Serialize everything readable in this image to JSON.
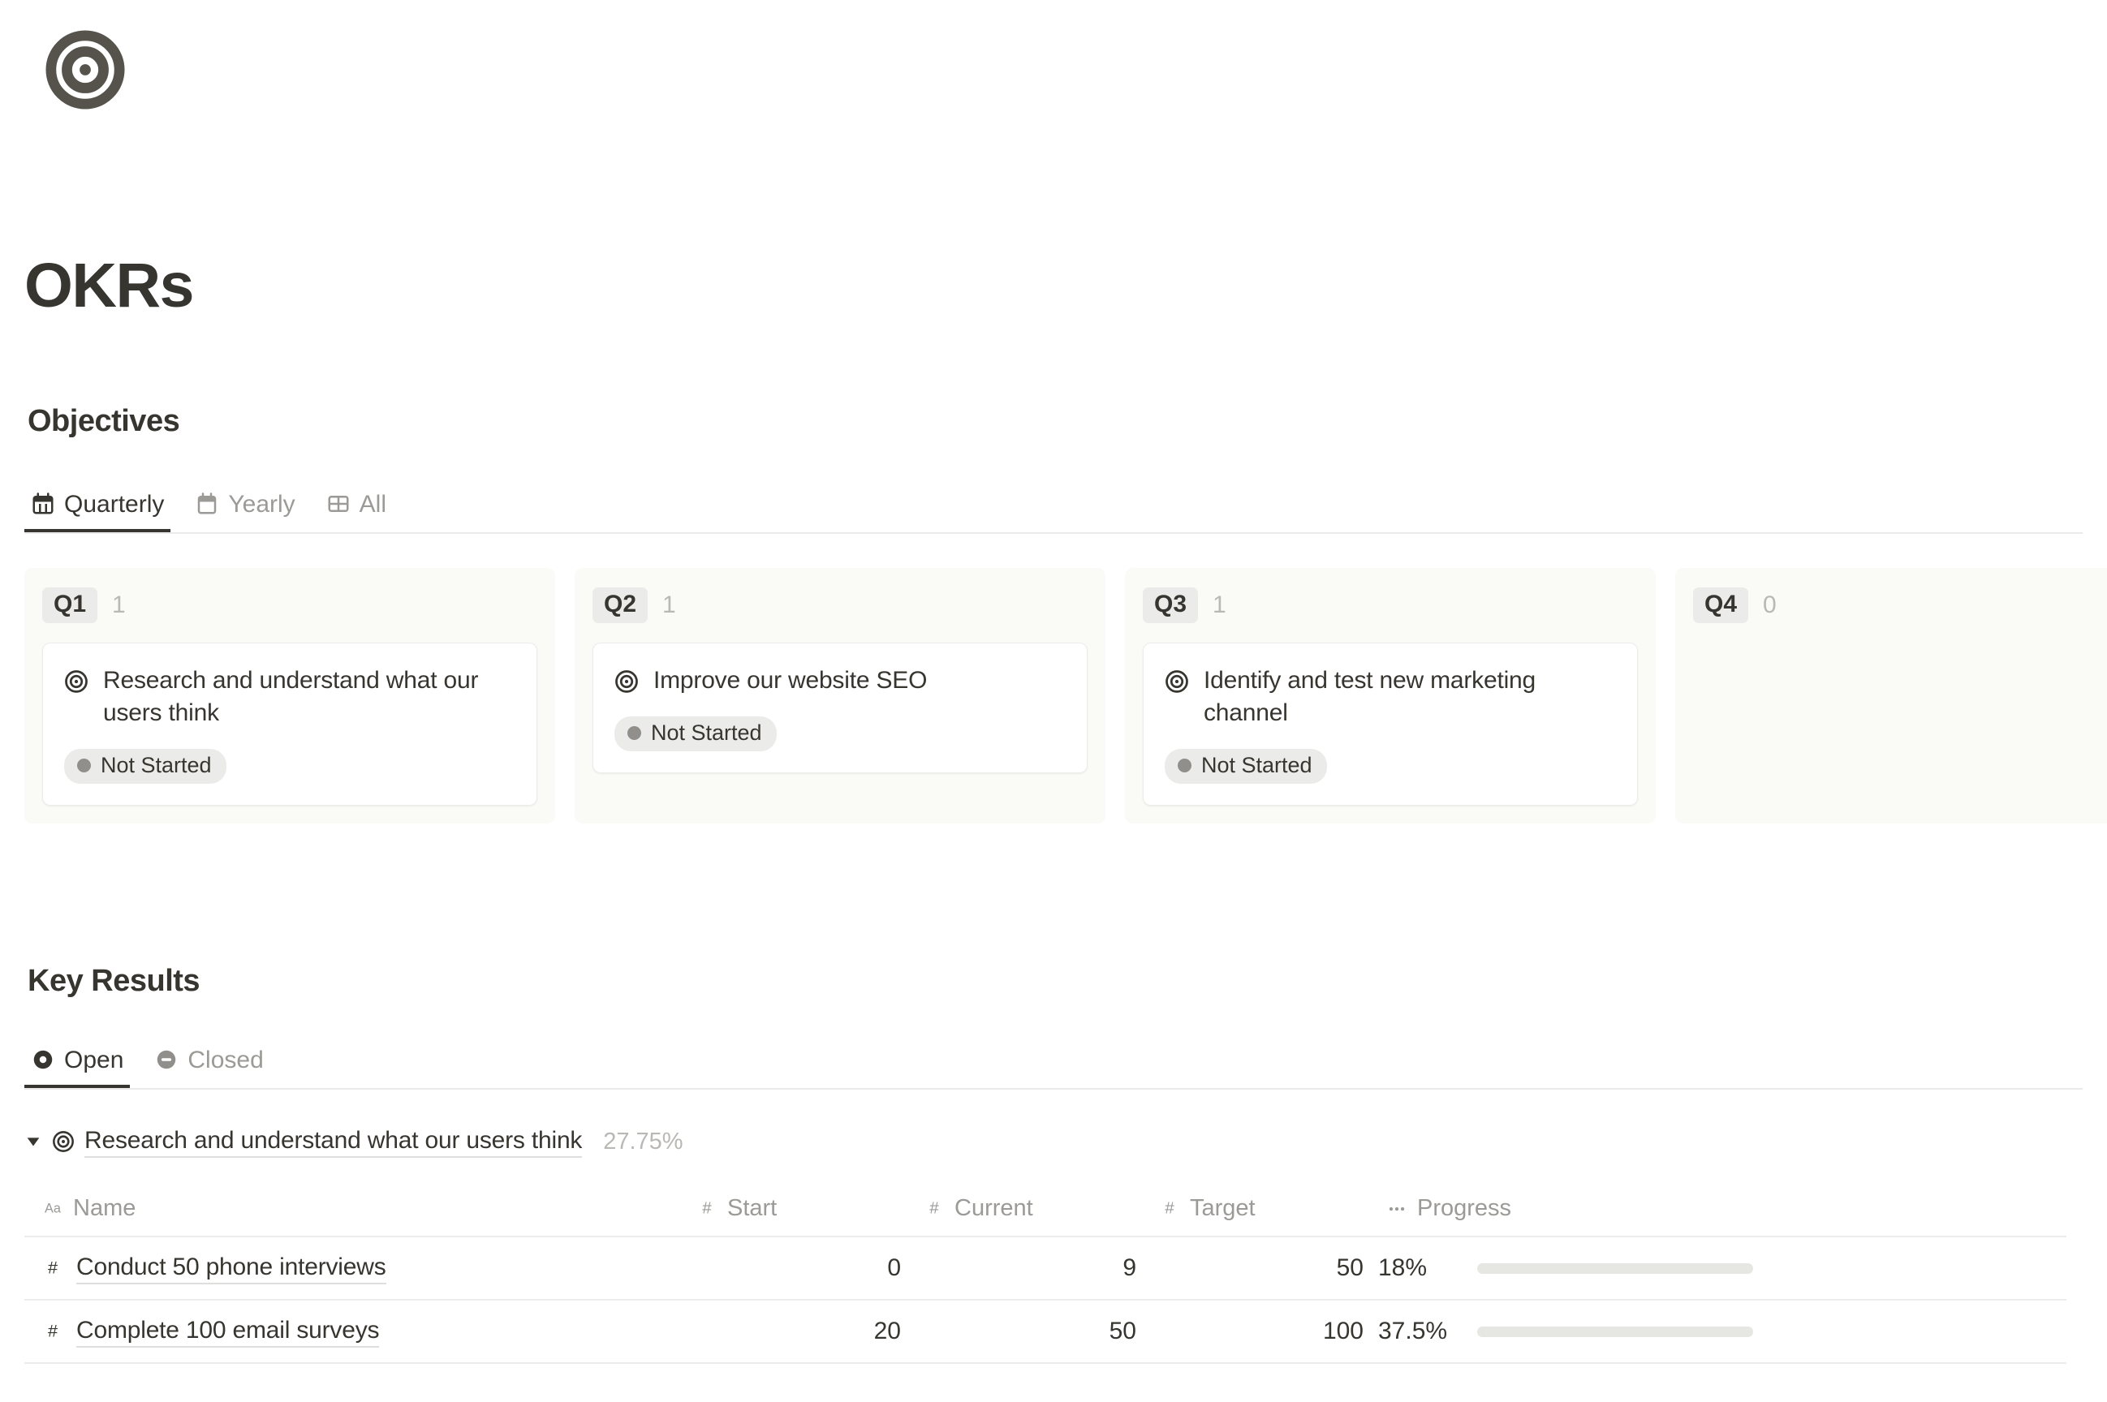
{
  "page": {
    "icon": "target-icon",
    "title": "OKRs"
  },
  "objectives": {
    "heading": "Objectives",
    "tabs": [
      {
        "label": "Quarterly",
        "icon": "calendar-grid-icon",
        "active": true
      },
      {
        "label": "Yearly",
        "icon": "calendar-icon",
        "active": false
      },
      {
        "label": "All",
        "icon": "table-icon",
        "active": false
      }
    ],
    "quarters": [
      {
        "label": "Q1",
        "count": "1",
        "cards": [
          {
            "icon": "target-icon",
            "title": "Research and understand what our users think",
            "status": "Not Started",
            "status_color": "#908f8c"
          }
        ]
      },
      {
        "label": "Q2",
        "count": "1",
        "cards": [
          {
            "icon": "target-icon",
            "title": "Improve our website SEO",
            "status": "Not Started",
            "status_color": "#908f8c"
          }
        ]
      },
      {
        "label": "Q3",
        "count": "1",
        "cards": [
          {
            "icon": "target-icon",
            "title": "Identify and test new marketing channel",
            "status": "Not Started",
            "status_color": "#908f8c"
          }
        ]
      },
      {
        "label": "Q4",
        "count": "0",
        "cards": []
      }
    ]
  },
  "key_results": {
    "heading": "Key Results",
    "tabs": [
      {
        "label": "Open",
        "icon": "open-circle-icon",
        "active": true
      },
      {
        "label": "Closed",
        "icon": "minus-circle-icon",
        "active": false
      }
    ],
    "group": {
      "caret": "caret-down-icon",
      "icon": "target-icon",
      "title": "Research and understand what our users think",
      "percent": "27.75%"
    },
    "columns": [
      {
        "label": "Name",
        "icon": "text-field-icon",
        "icon_glyph": "Aa"
      },
      {
        "label": "Start",
        "icon": "number-field-icon",
        "icon_glyph": "#"
      },
      {
        "label": "Current",
        "icon": "number-field-icon",
        "icon_glyph": "#"
      },
      {
        "label": "Target",
        "icon": "number-field-icon",
        "icon_glyph": "#"
      },
      {
        "label": "Progress",
        "icon": "formula-field-icon",
        "icon_glyph": "•••"
      }
    ],
    "rows": [
      {
        "icon": "number-field-icon",
        "name": "Conduct 50 phone interviews",
        "start": "0",
        "current": "9",
        "target": "50",
        "progress_label": "18%",
        "progress_value": 18
      },
      {
        "icon": "number-field-icon",
        "name": "Complete 100 email surveys",
        "start": "20",
        "current": "50",
        "target": "100",
        "progress_label": "37.5%",
        "progress_value": 37.5
      }
    ]
  },
  "colors": {
    "text": "#37352f",
    "muted": "#9b9a97",
    "column_bg": "#fafaf7",
    "chip_bg": "#ebebe9",
    "divider": "#ececeb",
    "progress_fill": "#9b9a97",
    "progress_track": "#e6e6e3"
  }
}
